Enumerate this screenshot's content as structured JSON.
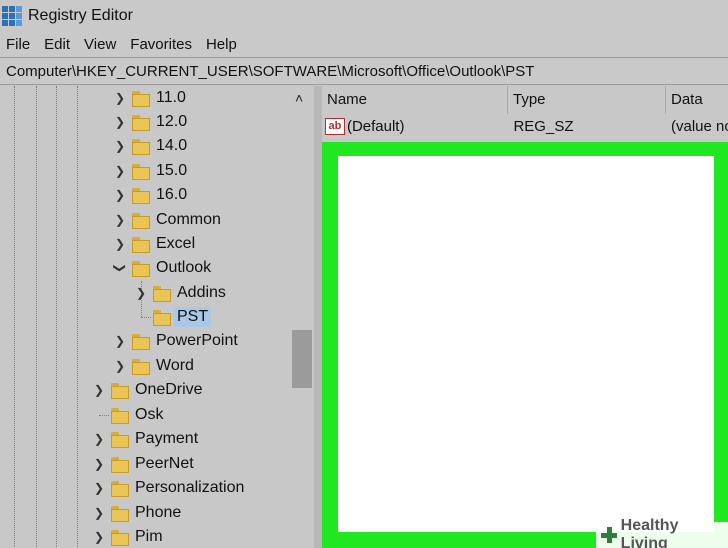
{
  "window": {
    "title": "Registry Editor"
  },
  "menu": [
    "File",
    "Edit",
    "View",
    "Favorites",
    "Help"
  ],
  "address": "Computer\\HKEY_CURRENT_USER\\SOFTWARE\\Microsoft\\Office\\Outlook\\PST",
  "tree": [
    {
      "label": "11.0",
      "expander": "chevron-right"
    },
    {
      "label": "12.0",
      "expander": "chevron-right"
    },
    {
      "label": "14.0",
      "expander": "chevron-right"
    },
    {
      "label": "15.0",
      "expander": "chevron-right"
    },
    {
      "label": "16.0",
      "expander": "chevron-right"
    },
    {
      "label": "Common",
      "expander": "chevron-right"
    },
    {
      "label": "Excel",
      "expander": "chevron-right"
    },
    {
      "label": "Outlook",
      "expander": "chevron-down"
    },
    {
      "label": "Addins",
      "expander": "chevron-right"
    },
    {
      "label": "PST",
      "expander": "none",
      "selected": true
    },
    {
      "label": "PowerPoint",
      "expander": "chevron-right"
    },
    {
      "label": "Word",
      "expander": "chevron-right"
    },
    {
      "label": "OneDrive",
      "expander": "chevron-right"
    },
    {
      "label": "Osk",
      "expander": "none"
    },
    {
      "label": "Payment",
      "expander": "chevron-right"
    },
    {
      "label": "PeerNet",
      "expander": "chevron-right"
    },
    {
      "label": "Personalization",
      "expander": "chevron-right"
    },
    {
      "label": "Phone",
      "expander": "chevron-right"
    },
    {
      "label": "Pim",
      "expander": "chevron-right"
    }
  ],
  "columns": {
    "name": "Name",
    "type": "Type",
    "data": "Data"
  },
  "values": [
    {
      "icon": "ab",
      "name": "(Default)",
      "type": "REG_SZ",
      "data": "(value no"
    }
  ],
  "highlight": {
    "color": "#20e820"
  },
  "watermark": {
    "text": "Healthy Living"
  }
}
